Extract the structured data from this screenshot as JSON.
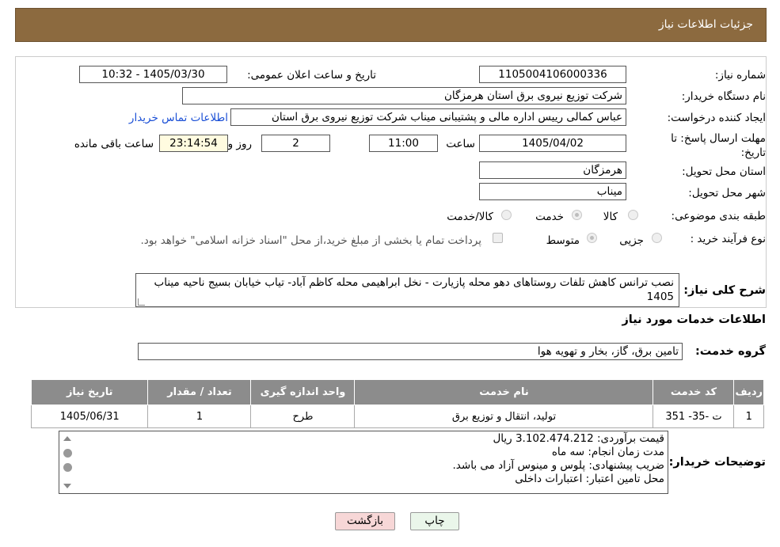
{
  "header": {
    "title": "جزئیات اطلاعات نیاز"
  },
  "form": {
    "need_number_label": "شماره نیاز:",
    "need_number": "1105004106000336",
    "announce_label": "تاریخ و ساعت اعلان عمومی:",
    "announce_value": "1405/03/30 - 10:32",
    "buyer_org_label": "نام دستگاه خریدار:",
    "buyer_org": "شرکت توزیع نیروی برق استان هرمزگان",
    "creator_label": "ایجاد کننده درخواست:",
    "creator": "عباس کمالی رییس اداره مالی و پشتیبانی میناب شرکت توزیع نیروی برق استان",
    "contact_link": "اطلاعات تماس خریدار",
    "deadline_label": "مهلت ارسال پاسخ: تا تاریخ:",
    "deadline_date": "1405/04/02",
    "time_label": "ساعت",
    "deadline_time": "11:00",
    "days_value": "2",
    "days_label": "روز و",
    "remaining_time": "23:14:54",
    "remaining_label": "ساعت باقی مانده",
    "province_label": "استان محل تحویل:",
    "province": "هرمزگان",
    "city_label": "شهر محل تحویل:",
    "city": "میناب",
    "category_label": "طبقه بندی موضوعی:",
    "category_options": [
      "کالا",
      "خدمت",
      "کالا/خدمت"
    ],
    "category_selected": "خدمت",
    "process_label": "نوع فرآیند خرید :",
    "process_options": [
      "جزیی",
      "متوسط"
    ],
    "process_selected": "متوسط",
    "payment_note": "پرداخت تمام یا بخشی از مبلغ خرید،از محل \"اسناد خزانه اسلامی\" خواهد بود.",
    "summary_label": "شرح کلی نیاز:",
    "summary": "نصب ترانس کاهش تلفات روستاهای دهو محله پازیارت - نخل ابراهیمی محله کاظم آباد-  تیاب خیابان بسیج ناحیه میناب  1405"
  },
  "services": {
    "section_title": "اطلاعات خدمات مورد نیاز",
    "group_label": "گروه خدمت:",
    "group_value": "تامین برق، گاز، بخار و تهویه هوا",
    "columns": [
      "ردیف",
      "کد خدمت",
      "نام خدمت",
      "واحد اندازه گیری",
      "تعداد / مقدار",
      "تاریخ نیاز"
    ],
    "rows": [
      {
        "row": "1",
        "code": "ت -35- 351",
        "name": "تولید، انتقال و توزیع برق",
        "unit": "طرح",
        "qty": "1",
        "date": "1405/06/31"
      }
    ]
  },
  "notes": {
    "label": "توضیحات خریدار:",
    "lines": [
      "قیمت برآوردی: 3.102.474.212 ریال",
      "مدت زمان انجام: سه ماه",
      "ضریب پیشنهادی: پلوس  و مینوس آزاد می باشد.",
      "محل تامین اعتبار:  اعتبارات  داخلی"
    ]
  },
  "buttons": {
    "print": "چاپ",
    "back": "بازگشت"
  },
  "colors": {
    "header": "#8c6a3f",
    "table_header": "#8c8c8c",
    "link": "#1a4fd6",
    "back_button": "#f7d7d7",
    "print_button": "#eaf6ea"
  }
}
